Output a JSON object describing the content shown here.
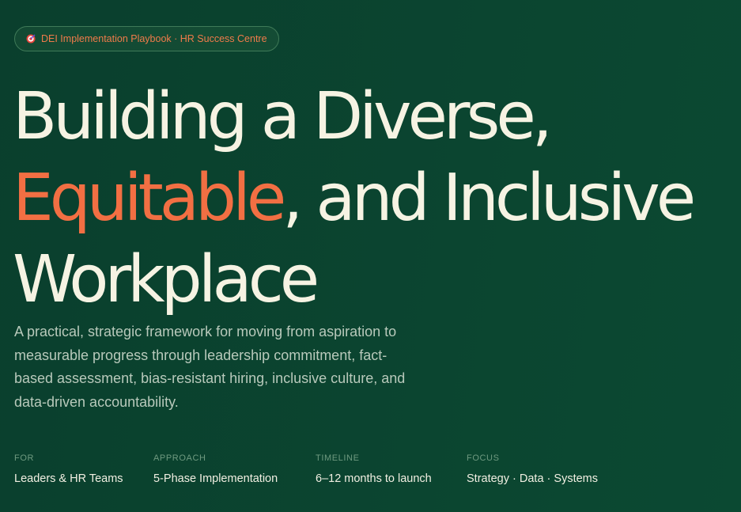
{
  "badge": {
    "icon": "target-icon",
    "text": "DEI Implementation Playbook · HR Success Centre"
  },
  "headline": {
    "line1": "Building a Diverse,",
    "line2_accent": "Equitable",
    "line2_rest": ", and Inclusive",
    "line3": "Workplace"
  },
  "subtitle": "A practical, strategic framework for moving from aspiration to measurable progress through leadership commitment, fact-based assessment, bias-resistant hiring, inclusive culture, and data-driven accountability.",
  "meta": [
    {
      "label": "FOR",
      "value": "Leaders & HR Teams"
    },
    {
      "label": "APPROACH",
      "value": "5-Phase Implementation"
    },
    {
      "label": "TIMELINE",
      "value": "6–12 months to launch"
    },
    {
      "label": "FOCUS",
      "value": "Strategy · Data · Systems"
    }
  ],
  "colors": {
    "background": "#0b4530",
    "accent": "#f26f43",
    "text": "#f6f3e3"
  }
}
